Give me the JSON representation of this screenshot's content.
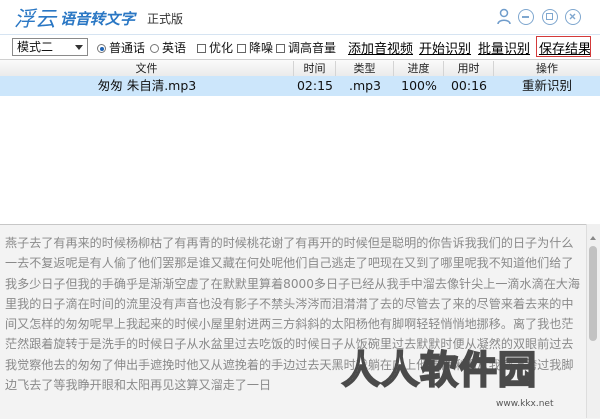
{
  "app": {
    "logo": "浮云",
    "name": "语音转文字",
    "edition": "正式版"
  },
  "toolbar": {
    "mode_value": "模式二",
    "radio_mandarin": "普通话",
    "radio_english": "英语",
    "check_optimize": "优化",
    "check_denoise": "降噪",
    "check_boost": "调高音量",
    "add_av": "添加音视频",
    "start": "开始识别",
    "batch": "批量识别",
    "save": "保存结果"
  },
  "table": {
    "headers": [
      "文件",
      "时间",
      "类型",
      "进度",
      "用时",
      "操作"
    ],
    "rows": [
      {
        "file": "匆匆  朱自清.mp3",
        "time": "02:15",
        "type": ".mp3",
        "progress": "100%",
        "elapsed": "00:16",
        "action": "重新识别"
      }
    ]
  },
  "result_text": "燕子去了有再来的时候杨柳枯了有再青的时候桃花谢了有再开的时候但是聪明的你告诉我我们的日子为什么一去不复返呢是有人偷了他们罢那是谁又藏在何处呢他们自己逃走了吧现在又到了哪里呢我不知道他们给了我多少日子但我的手确乎是渐渐空虚了在默默里算着8000多日子已经从我手中溜去像针尖上一滴水滴在大海里我的日子滴在时间的流里没有声音也没有影子不禁头涔涔而泪潸潸了去的尽管去了来的尽管来着去来的中间又怎样的匆匆呢早上我起来的时候小屋里射进两三方斜斜的太阳杨他有脚啊轻轻悄悄地挪移。离了我也茫茫然跟着旋转于是洗手的时候日子从水盆里过去吃饭的时候日子从饭碗里过去默默时便从凝然的双眼前过去我觉察他去的匆匆了伸出手遮挽时他又从遮挽着的手边过去天黑时我躺在床上他便伶俐俐从我身上跨过我脚边飞去了等我睁开眼和太阳再见这算又溜走了一日",
  "watermark": {
    "text": "人人软件园",
    "url": "www.kkx.net"
  }
}
